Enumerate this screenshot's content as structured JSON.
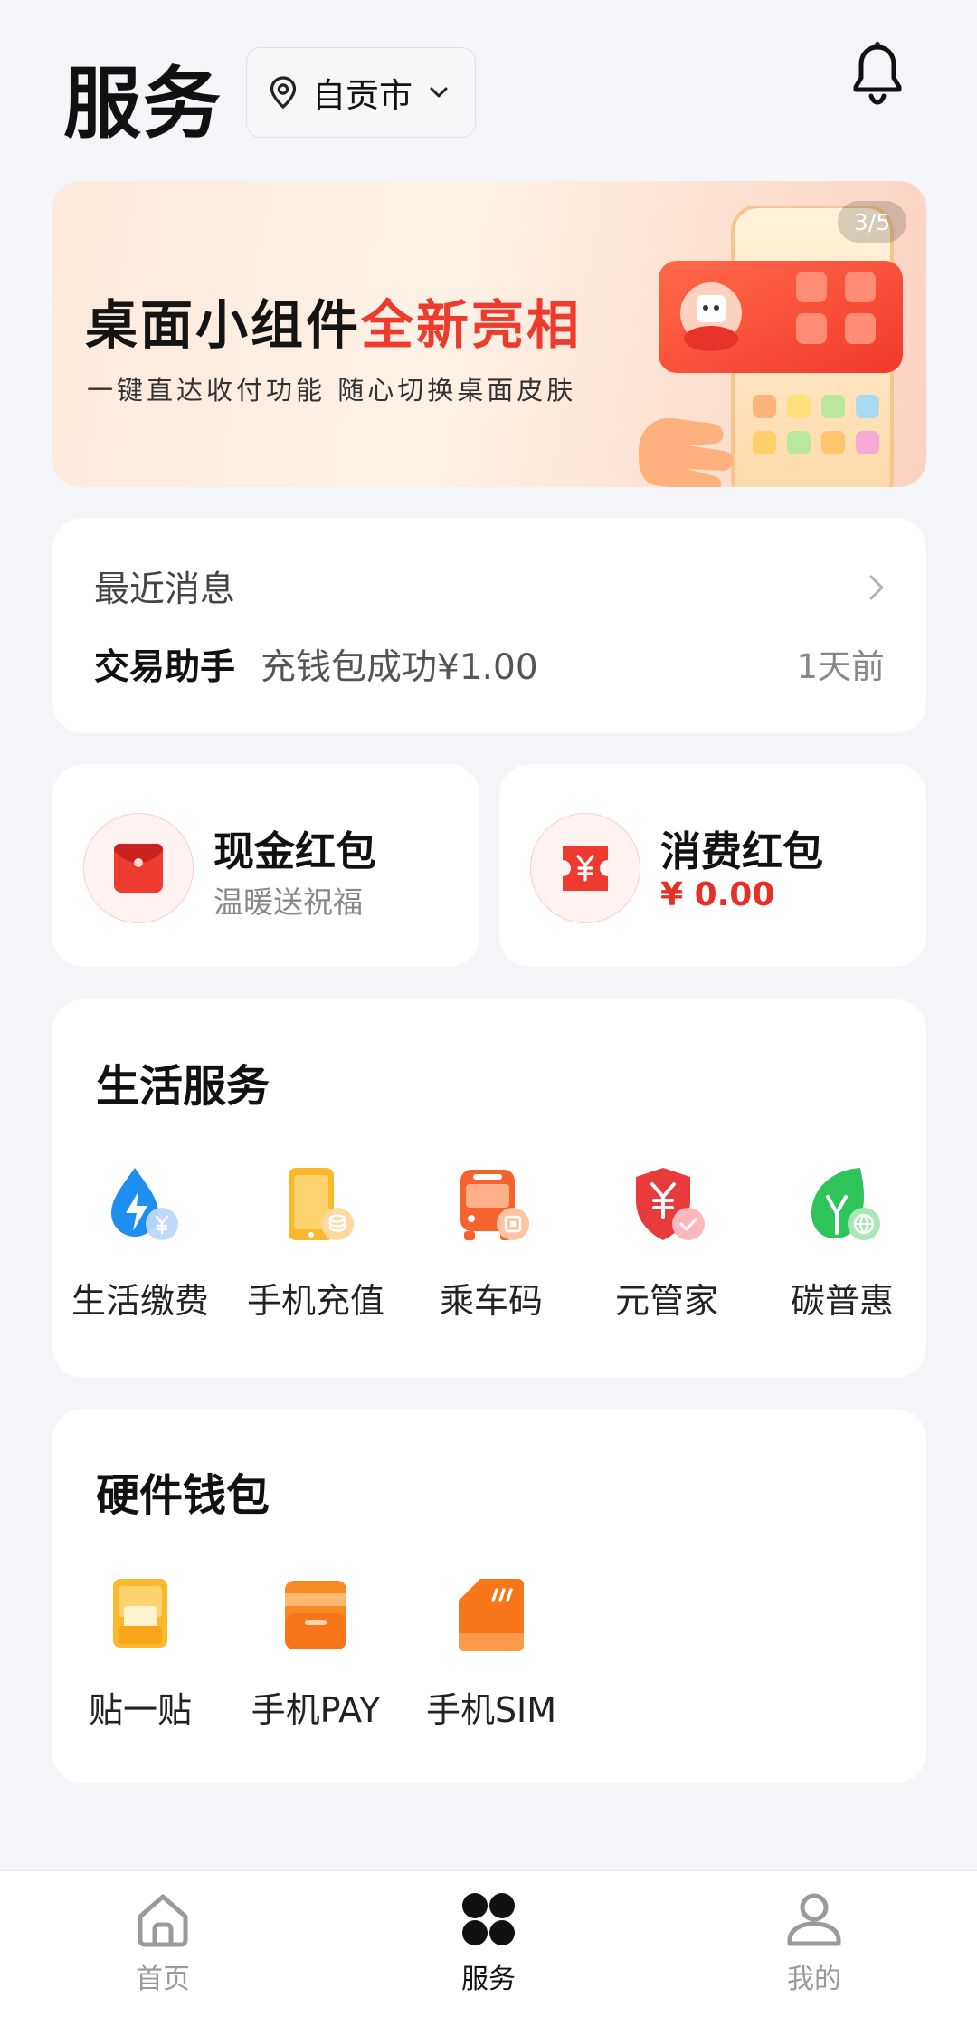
{
  "header": {
    "title": "服务",
    "city": "自贡市"
  },
  "banner": {
    "title_main": "桌面小组件",
    "title_accent": "全新亮相",
    "subtitle": "一键直达收付功能  随心切换桌面皮肤",
    "pager": "3/5"
  },
  "messages": {
    "heading": "最近消息",
    "sender": "交易助手",
    "text": "充钱包成功¥1.00",
    "time": "1天前"
  },
  "red_packets": {
    "cash": {
      "title": "现金红包",
      "subtitle": "温暖送祝福"
    },
    "spend": {
      "title": "消费红包",
      "amount": "¥ 0.00"
    }
  },
  "life_services": {
    "title": "生活服务",
    "items": [
      {
        "label": "生活缴费",
        "icon": "water-bolt-icon"
      },
      {
        "label": "手机充值",
        "icon": "phone-recharge-icon"
      },
      {
        "label": "乘车码",
        "icon": "bus-code-icon"
      },
      {
        "label": "元管家",
        "icon": "yuan-shield-icon"
      },
      {
        "label": "碳普惠",
        "icon": "green-leaf-icon"
      }
    ]
  },
  "hardware_wallet": {
    "title": "硬件钱包",
    "items": [
      {
        "label": "贴一贴",
        "icon": "tap-icon"
      },
      {
        "label": "手机PAY",
        "icon": "card-icon"
      },
      {
        "label": "手机SIM",
        "icon": "sim-icon"
      }
    ]
  },
  "bottom_nav": [
    {
      "label": "首页",
      "icon": "home-icon",
      "active": false
    },
    {
      "label": "服务",
      "icon": "services-icon",
      "active": true
    },
    {
      "label": "我的",
      "icon": "profile-icon",
      "active": false
    }
  ],
  "colors": {
    "accent_red": "#e5302a",
    "page_bg": "#f4f5f8",
    "card_bg": "#ffffff"
  }
}
